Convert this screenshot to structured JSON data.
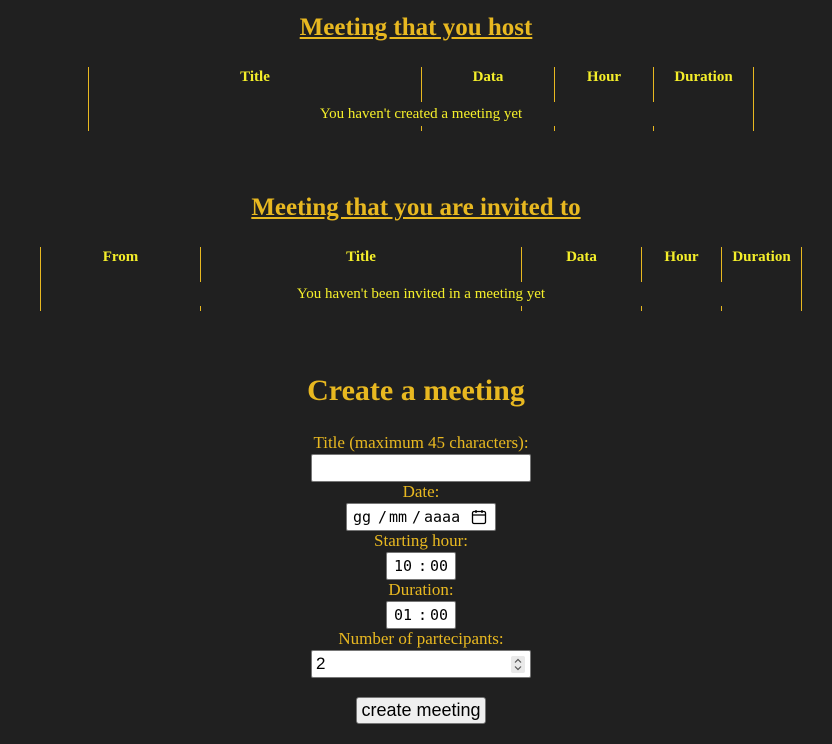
{
  "hosted": {
    "heading": "Meeting that you host",
    "columns": [
      "Title",
      "Data",
      "Hour",
      "Duration"
    ],
    "empty_message": "You haven't created a meeting yet"
  },
  "invited": {
    "heading": "Meeting that you are invited to",
    "columns": [
      "From",
      "Title",
      "Data",
      "Hour",
      "Duration"
    ],
    "empty_message": "You haven't been invited in a meeting yet"
  },
  "create": {
    "heading": "Create a meeting",
    "title_label": "Title (maximum 45 characters):",
    "title_value": "",
    "date_label": "Date:",
    "date_placeholder": {
      "day": "gg",
      "month": "mm",
      "year": "aaaa",
      "sep": "/"
    },
    "start_label": "Starting hour:",
    "start_value": {
      "h": "10",
      "m": "00",
      "sep": ":"
    },
    "duration_label": "Duration:",
    "duration_value": {
      "h": "01",
      "m": "00",
      "sep": ":"
    },
    "participants_label": "Number of partecipants:",
    "participants_value": "2",
    "submit_label": "create meeting"
  },
  "colors": {
    "background": "#202020",
    "accent": "#e8b820",
    "table_text": "#f4ee2a"
  }
}
